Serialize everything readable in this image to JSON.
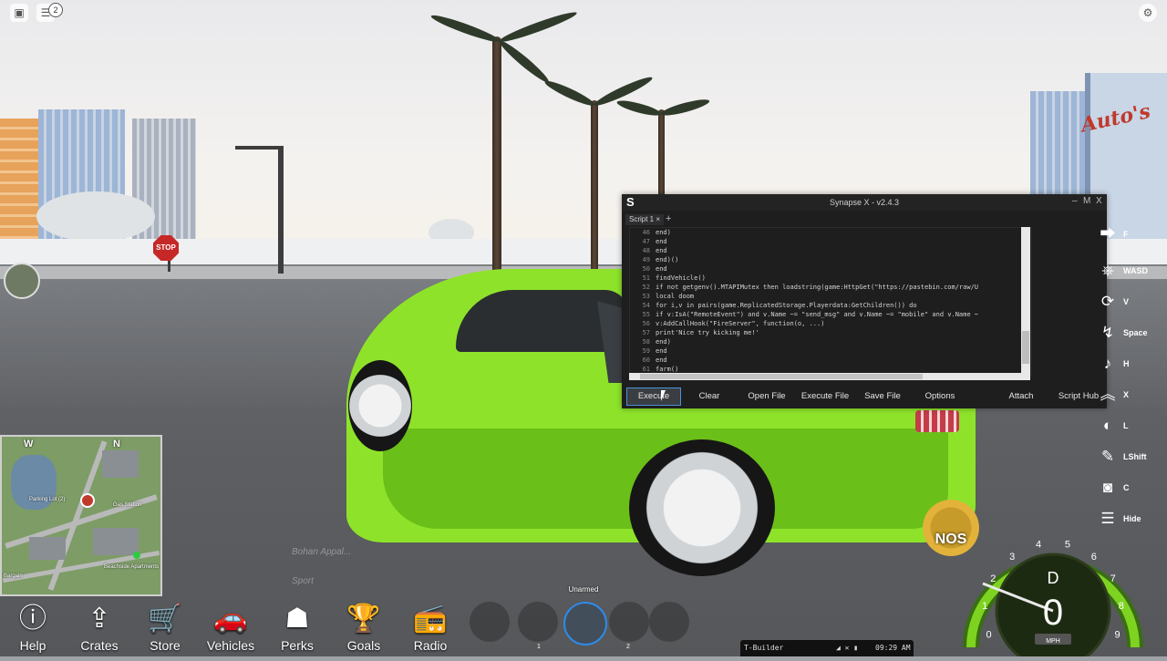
{
  "top_bar": {
    "menu_icon": "roblox-menu-icon",
    "chat_icon": "chat-icon",
    "notification_count": "2",
    "settings_icon": "settings-icon"
  },
  "dealership": {
    "sign": "Auto's"
  },
  "scene_signs": {
    "stop": "STOP"
  },
  "executor": {
    "logo": "S",
    "title": "Synapse X - v2.4.3",
    "controls": [
      "–",
      "M",
      "X"
    ],
    "tab": "Script 1 ×",
    "tab_add": "+",
    "code_lines": [
      {
        "n": "46",
        "code": "end)"
      },
      {
        "n": "47",
        "code": "end"
      },
      {
        "n": "48",
        "code": "end"
      },
      {
        "n": "49",
        "code": "end)()"
      },
      {
        "n": "50",
        "code": "end"
      },
      {
        "n": "51",
        "code": "findVehicle()"
      },
      {
        "n": "52",
        "code": "if not getgenv().MTAPIMutex then loadstring(game:HttpGet(\"https://pastebin.com/raw/U"
      },
      {
        "n": "53",
        "code": "local doom"
      },
      {
        "n": "54",
        "code": "for i,v in pairs(game.ReplicatedStorage.Playerdata:GetChildren()) do"
      },
      {
        "n": "55",
        "code": "if v:IsA(\"RemoteEvent\") and v.Name ~= \"send_msg\" and v.Name ~= \"mobile\" and v.Name ~"
      },
      {
        "n": "56",
        "code": "v:AddCallHook(\"FireServer\", function(o, ...)"
      },
      {
        "n": "57",
        "code": "print'Nice try kicking me!'"
      },
      {
        "n": "58",
        "code": "end)"
      },
      {
        "n": "59",
        "code": "end"
      },
      {
        "n": "60",
        "code": "end"
      },
      {
        "n": "61",
        "code": "farm()"
      }
    ],
    "buttons": {
      "execute": "Execute",
      "clear": "Clear",
      "open_file": "Open File",
      "execute_file": "Execute File",
      "save_file": "Save File",
      "options": "Options",
      "attach": "Attach",
      "script_hub": "Script Hub"
    }
  },
  "keybinds": [
    {
      "icon": "exit-vehicle-icon",
      "glyph": "⮕",
      "key": "F"
    },
    {
      "icon": "steering-wheel-icon",
      "glyph": "⎈",
      "key": "WASD"
    },
    {
      "icon": "flip-icon",
      "glyph": "⟳",
      "key": "V"
    },
    {
      "icon": "drift-icon",
      "glyph": "↯",
      "key": "Space"
    },
    {
      "icon": "horn-icon",
      "glyph": "♪",
      "key": "H"
    },
    {
      "icon": "chevrons-up-icon",
      "glyph": "︽",
      "key": "X"
    },
    {
      "icon": "headlights-icon",
      "glyph": "◐",
      "key": "L"
    },
    {
      "icon": "nitro-icon",
      "glyph": "✎",
      "key": "LShift"
    },
    {
      "icon": "camera-icon",
      "glyph": "◙",
      "key": "C"
    },
    {
      "icon": "hamburger-icon",
      "glyph": "☰",
      "key": "Hide"
    }
  ],
  "minimap": {
    "compass_w": "W",
    "compass_n": "N",
    "labels": [
      "Parking Lot (2)",
      "Gas Station",
      "Beachside Apartments",
      "Bargain"
    ]
  },
  "watermarks": [
    "Bohan Appal...",
    "Sport"
  ],
  "hud_buttons": [
    {
      "name": "help",
      "glyph": "ⓘ",
      "label": "Help"
    },
    {
      "name": "crates",
      "glyph": "⇪",
      "label": "Crates"
    },
    {
      "name": "store",
      "glyph": "🛒",
      "label": "Store"
    },
    {
      "name": "vehicles",
      "glyph": "🚗",
      "label": "Vehicles"
    },
    {
      "name": "perks",
      "glyph": "☗",
      "label": "Perks"
    },
    {
      "name": "goals",
      "glyph": "🏆",
      "label": "Goals"
    },
    {
      "name": "radio",
      "glyph": "📻",
      "label": "Radio"
    }
  ],
  "hotbar": {
    "equipped": "Unarmed",
    "slot_numbers": [
      "1",
      "2"
    ]
  },
  "taskbar": {
    "app": "T-Builder",
    "time": "09:29 AM"
  },
  "speedometer": {
    "gear": "D",
    "speed": "0",
    "unit": "MPH",
    "ticks": [
      "0",
      "1",
      "2",
      "3",
      "4",
      "5",
      "6",
      "7",
      "8",
      "9"
    ],
    "nos_label": "NOS",
    "accent": "#7ed321"
  }
}
